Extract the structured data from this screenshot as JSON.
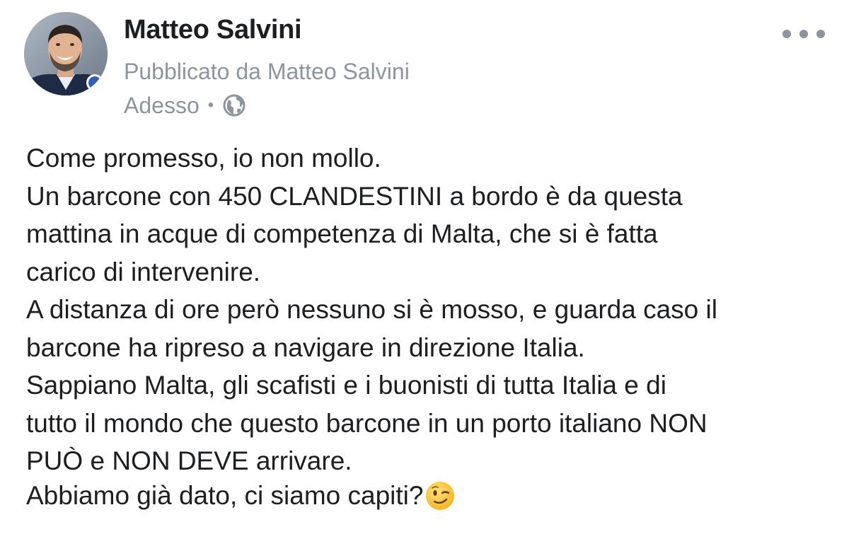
{
  "post": {
    "author": "Matteo Salvini",
    "published_by": "Pubblicato da Matteo Salvini",
    "timestamp": "Adesso",
    "separator": "•",
    "audience_icon": "globe-icon",
    "more_icon": "more-options-icon",
    "paragraphs": [
      "Come promesso, io non mollo.\nUn barcone con 450 CLANDESTINI a bordo è da questa\nmattina in acque di competenza di Malta, che si è fatta\ncarico di intervenire.\nA distanza di ore però nessuno si è mosso, e guarda caso il\nbarcone ha ripreso a navigare in direzione Italia.\nSappiano Malta, gli scafisti e i buonisti di tutta Italia e di\ntutto il mondo che questo barcone in un porto italiano NON\nPUÒ e NON DEVE arrivare."
    ],
    "closing": "Abbiamo già dato, ci siamo capiti?",
    "closing_emoji": "winking-face-emoji"
  },
  "colors": {
    "text_primary": "#1c1e21",
    "text_secondary": "#8d949e",
    "background": "#ffffff",
    "emoji_yellow": "#f9c02e"
  }
}
